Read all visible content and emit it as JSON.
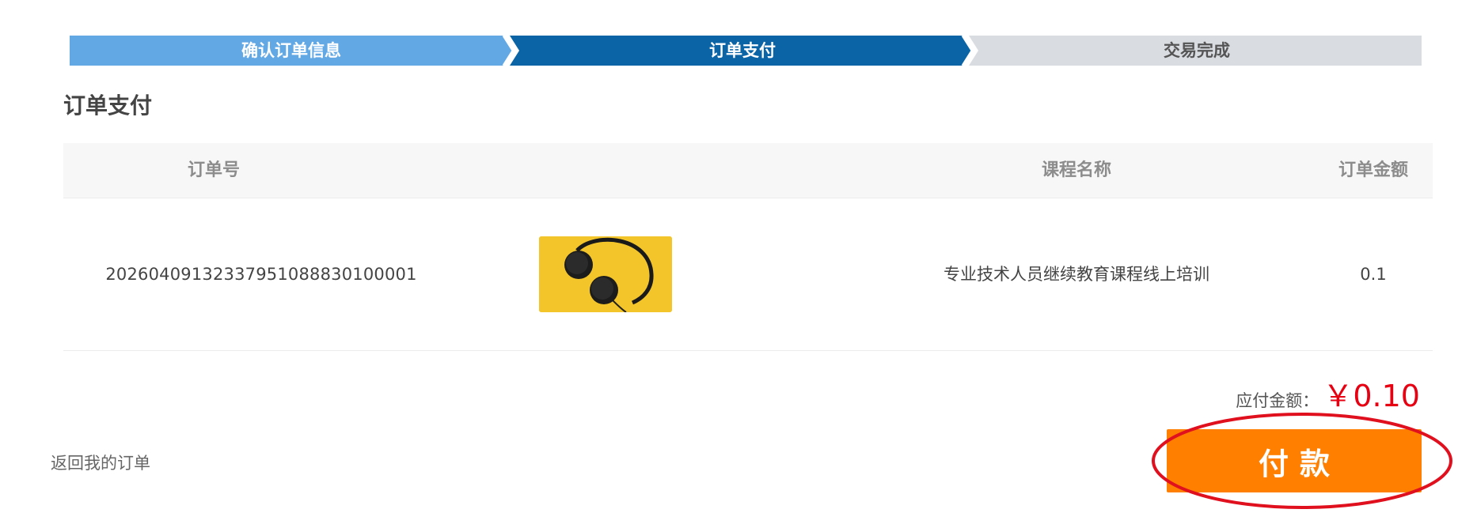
{
  "stepper": {
    "steps": [
      {
        "label": "确认订单信息",
        "state": "done"
      },
      {
        "label": "订单支付",
        "state": "active"
      },
      {
        "label": "交易完成",
        "state": "pending"
      }
    ],
    "colors": {
      "done": "#62a8e5",
      "active": "#0a64a6",
      "pending": "#d9dce1"
    }
  },
  "page_title": "订单支付",
  "table": {
    "headers": {
      "order_no": "订单号",
      "course_name": "课程名称",
      "amount": "订单金额"
    },
    "rows": [
      {
        "order_no": "20260409132337951088830100001",
        "thumbnail": "headphones-on-yellow-image",
        "course_name": "专业技术人员继续教育课程线上培训",
        "amount": "0.1"
      }
    ]
  },
  "payment": {
    "due_label": "应付金额：",
    "due_value": "￥0.10",
    "pay_button_label": "付款",
    "accent_color": "#ff7f00",
    "price_color": "#e60012"
  },
  "back_link_label": "返回我的订单",
  "annotation": {
    "shape": "ellipse",
    "color": "#e0101e",
    "target": "pay-button"
  }
}
